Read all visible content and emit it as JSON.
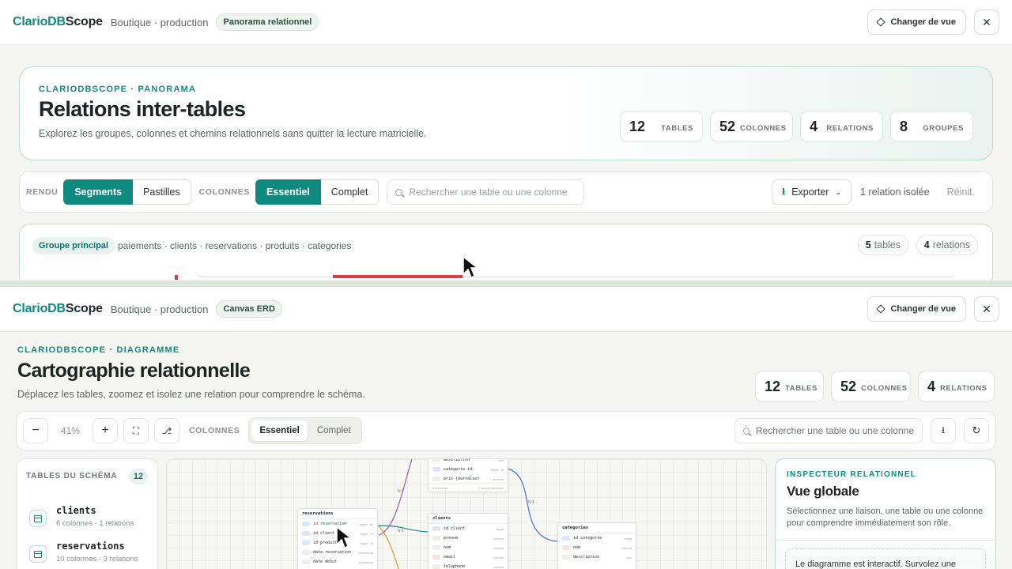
{
  "brand": {
    "part1": "ClarioDB",
    "part2": "Scope"
  },
  "panel1": {
    "crumb": "Boutique · production",
    "tag": "Panorama relationnel",
    "change_view": "Changer de vue",
    "close": "✕",
    "eyebrow": "CLARIODBSCOPE · PANORAMA",
    "title": "Relations inter-tables",
    "subtitle": "Explorez les groupes, colonnes et chemins relationnels sans quitter la lecture matricielle.",
    "stats": [
      {
        "n": "12",
        "l": "TABLES"
      },
      {
        "n": "52",
        "l": "COLONNES"
      },
      {
        "n": "4",
        "l": "RELATIONS"
      },
      {
        "n": "8",
        "l": "GROUPES"
      }
    ],
    "toolbar": {
      "rendu_label": "RENDU",
      "rendu_opts": [
        "Segments",
        "Pastilles"
      ],
      "colonnes_label": "COLONNES",
      "colonnes_opts": [
        "Essentiel",
        "Complet"
      ],
      "search_placeholder": "Rechercher une table ou une colonne",
      "export": "Exporter",
      "isolated": "1 relation isolée",
      "reset": "Réinit."
    },
    "group": {
      "badge": "Groupe principal",
      "tables": "paiements · clients · reservations · produits · categories",
      "tables_count": "5",
      "tables_word": "tables",
      "relations_count": "4",
      "relations_word": "relations"
    }
  },
  "panel2": {
    "crumb": "Boutique · production",
    "tag": "Canvas ERD",
    "change_view": "Changer de vue",
    "close": "✕",
    "eyebrow": "CLARIODBSCOPE · DIAGRAMME",
    "title": "Cartographie relationnelle",
    "subtitle": "Déplacez les tables, zoomez et isolez une relation pour comprendre le schéma.",
    "stats": [
      {
        "n": "12",
        "l": "TABLES"
      },
      {
        "n": "52",
        "l": "COLONNES"
      },
      {
        "n": "4",
        "l": "RELATIONS"
      }
    ],
    "toolbar": {
      "zoom": "41%",
      "colonnes_label": "COLONNES",
      "colonnes_opts": [
        "Essentiel",
        "Complet"
      ],
      "search_placeholder": "Rechercher une table ou une colonne"
    },
    "sidebar": {
      "title": "TABLES DU SCHÉMA",
      "count": "12",
      "items": [
        {
          "name": "clients",
          "meta": "6 colonnes · 1 relations"
        },
        {
          "name": "reservations",
          "meta": "10 colonnes · 3 relations"
        }
      ]
    },
    "erd": {
      "reservations": {
        "title": "reservations",
        "rows": [
          {
            "key": "PK",
            "name": "id reservation",
            "type": "bigint · pk"
          },
          {
            "key": "FK",
            "name": "id client",
            "type": "bigint · fk"
          },
          {
            "key": "FK",
            "name": "id produit",
            "type": "bigint · fk"
          },
          {
            "key": "",
            "name": "date reservation",
            "type": "timestamp"
          },
          {
            "key": "",
            "name": "date debut",
            "type": "timestamp"
          }
        ]
      },
      "clients": {
        "title": "clients",
        "rows": [
          {
            "key": "PK",
            "name": "id client",
            "type": "bigint"
          },
          {
            "key": "",
            "name": "prenom",
            "type": "varchar"
          },
          {
            "key": "",
            "name": "nom",
            "type": "varchar"
          },
          {
            "key": "UQ",
            "name": "email",
            "type": "varchar"
          },
          {
            "key": "",
            "name": "telephone",
            "type": "varchar"
          }
        ]
      },
      "produits": {
        "rows": [
          {
            "key": "",
            "name": "description",
            "type": "text"
          },
          {
            "key": "FK",
            "name": "categorie id",
            "type": "bigint · fk"
          },
          {
            "key": "",
            "name": "prix journalier",
            "type": "decimal"
          }
        ],
        "footer": "8 colonnes",
        "footer2": "2 autres colonnes"
      },
      "categories": {
        "title": "categories",
        "rows": [
          {
            "key": "PK",
            "name": "id categorie",
            "type": "bigint"
          },
          {
            "key": "UQ",
            "name": "nom",
            "type": "varchar"
          },
          {
            "key": "",
            "name": "description",
            "type": "text"
          }
        ]
      },
      "edge_labels": [
        "N:1",
        "N:1",
        "N:1"
      ]
    },
    "inspector": {
      "eyebrow": "INSPECTEUR RELATIONNEL",
      "title": "Vue globale",
      "text": "Sélectionnez une liaison, une table ou une colonne pour comprendre immédiatement son rôle.",
      "note": "Le diagramme est interactif. Survolez une"
    }
  }
}
